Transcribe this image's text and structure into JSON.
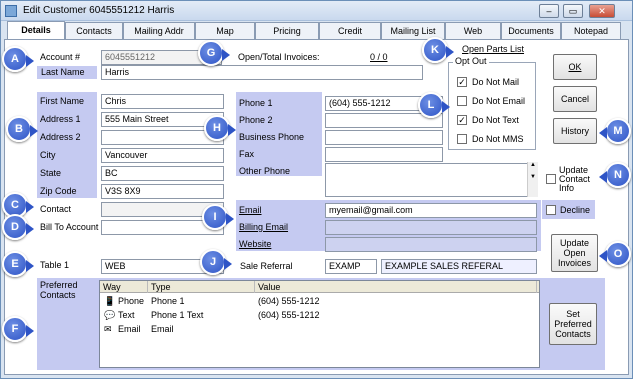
{
  "window": {
    "title": "Edit Customer 6045551212 Harris",
    "minimize": "–",
    "restore": "▭",
    "close": "✕"
  },
  "tabs": [
    "Details",
    "Contacts",
    "Mailing Addr",
    "Map",
    "Pricing",
    "Credit",
    "Mailing List",
    "Web",
    "Documents",
    "Notepad"
  ],
  "account": {
    "label": "Account #",
    "value": "6045551212"
  },
  "open_total": {
    "label": "Open/Total Invoices:",
    "value": "0 / 0"
  },
  "open_parts_link": "Open Parts List",
  "last_name": {
    "label": "Last Name",
    "value": "Harris"
  },
  "first_name": {
    "label": "First Name",
    "value": "Chris"
  },
  "address1": {
    "label": "Address 1",
    "value": "555 Main Street"
  },
  "address2": {
    "label": "Address 2",
    "value": ""
  },
  "city": {
    "label": "City",
    "value": "Vancouver"
  },
  "state": {
    "label": "State",
    "value": "BC"
  },
  "zip": {
    "label": "Zip Code",
    "value": "V3S 8X9"
  },
  "contact": {
    "label": "Contact",
    "value": ""
  },
  "bill_to": {
    "label": "Bill To Account",
    "value": ""
  },
  "table1": {
    "label": "Table 1",
    "value": "WEB"
  },
  "phones": {
    "phone1": {
      "label": "Phone 1",
      "value": "(604) 555-1212"
    },
    "phone2": {
      "label": "Phone 2",
      "value": ""
    },
    "business": {
      "label": "Business Phone",
      "value": ""
    },
    "fax": {
      "label": "Fax",
      "value": ""
    },
    "other": {
      "label": "Other Phone",
      "value": ""
    }
  },
  "email": {
    "label": "Email",
    "value": "myemail@gmail.com"
  },
  "billing_email": {
    "label": "Billing Email",
    "value": ""
  },
  "website": {
    "label": "Website",
    "value": ""
  },
  "sale_referral": {
    "label": "Sale Referral",
    "code": "EXAMP",
    "description": "EXAMPLE SALES REFERAL"
  },
  "optout": {
    "legend": "Opt Out",
    "items": [
      {
        "label": "Do Not Mail",
        "checked": true
      },
      {
        "label": "Do Not Email",
        "checked": false
      },
      {
        "label": "Do Not Text",
        "checked": true
      },
      {
        "label": "Do Not MMS",
        "checked": false
      }
    ]
  },
  "buttons": {
    "ok": "OK",
    "cancel": "Cancel",
    "history": "History",
    "update_open_invoices": "Update Open Invoices",
    "set_preferred_contacts": "Set Preferred Contacts"
  },
  "update_contact_info": "Update Contact Info",
  "decline": "Decline",
  "preferred_contacts": {
    "label": "Preferred Contacts",
    "columns": [
      "Way",
      "Type",
      "Value"
    ],
    "rows": [
      {
        "way": "Phone",
        "type": "Phone 1",
        "value": "(604) 555-1212"
      },
      {
        "way": "Text",
        "type": "Phone 1 Text",
        "value": "(604) 555-1212"
      },
      {
        "way": "Email",
        "type": "Email",
        "value": ""
      }
    ]
  },
  "markers": [
    "A",
    "B",
    "C",
    "D",
    "E",
    "F",
    "G",
    "H",
    "I",
    "J",
    "K",
    "L",
    "M",
    "N",
    "O"
  ],
  "colors": {
    "label_band": "#c5caf1",
    "marker": "#2e54c6"
  }
}
